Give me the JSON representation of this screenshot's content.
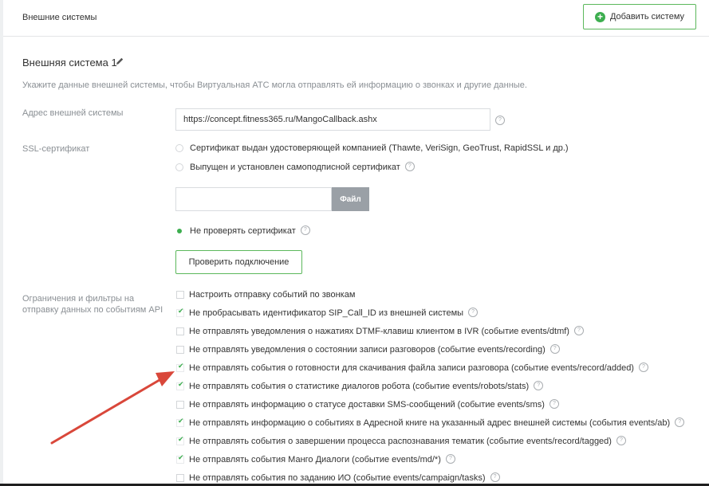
{
  "header": {
    "title": "Внешние системы",
    "add_button_label": "Добавить систему"
  },
  "section": {
    "title": "Внешняя система 1",
    "description": "Укажите данные внешней системы, чтобы Виртуальная АТС могла отправлять ей информацию о звонках и другие данные."
  },
  "address": {
    "label": "Адрес внешней системы",
    "value": "https://concept.fitness365.ru/MangoCallback.ashx"
  },
  "ssl": {
    "label": "SSL-сертификат",
    "options": [
      "Сертификат выдан удостоверяющей компанией (Thawte, VeriSign, GeoTrust, RapidSSL и др.)",
      "Выпущен и установлен самоподписной сертификат",
      "Не проверять сертификат"
    ],
    "selected": 2,
    "file_button_label": "Файл",
    "check_button_label": "Проверить подключение"
  },
  "filters": {
    "label": "Ограничения и фильтры на отправку данных по событиям API",
    "items": [
      {
        "label": "Настроить отправку событий по звонкам",
        "checked": false,
        "help": false
      },
      {
        "label": "Не пробрасывать идентификатор SIP_Call_ID из внешней системы",
        "checked": true,
        "help": true
      },
      {
        "label": "Не отправлять уведомления о нажатиях DTMF-клавиш клиентом в IVR (событие events/dtmf)",
        "checked": false,
        "help": true
      },
      {
        "label": "Не отправлять уведомления о состоянии записи разговоров (событие events/recording)",
        "checked": false,
        "help": true
      },
      {
        "label": "Не отправлять события о готовности для скачивания файла записи разговора (событие events/record/added)",
        "checked": true,
        "help": true
      },
      {
        "label": "Не отправлять события о статистике диалогов робота (событие events/robots/stats)",
        "checked": true,
        "help": true
      },
      {
        "label": "Не отправлять информацию о статусе доставки SMS-сообщений (событие events/sms)",
        "checked": false,
        "help": true
      },
      {
        "label": "Не отправлять информацию о событиях в Адресной книге на указанный адрес внешней системы (события events/ab)",
        "checked": true,
        "help": true
      },
      {
        "label": "Не отправлять события о завершении процесса распознавания тематик (событие events/record/tagged)",
        "checked": true,
        "help": true
      },
      {
        "label": "Не отправлять события Манго Диалоги (событие events/md/*)",
        "checked": true,
        "help": true
      },
      {
        "label": "Не отправлять события по заданию ИО (событие events/campaign/tasks)",
        "checked": false,
        "help": true
      }
    ]
  },
  "colors": {
    "accent": "#3dae4f",
    "annotation_arrow": "#d9473a"
  }
}
